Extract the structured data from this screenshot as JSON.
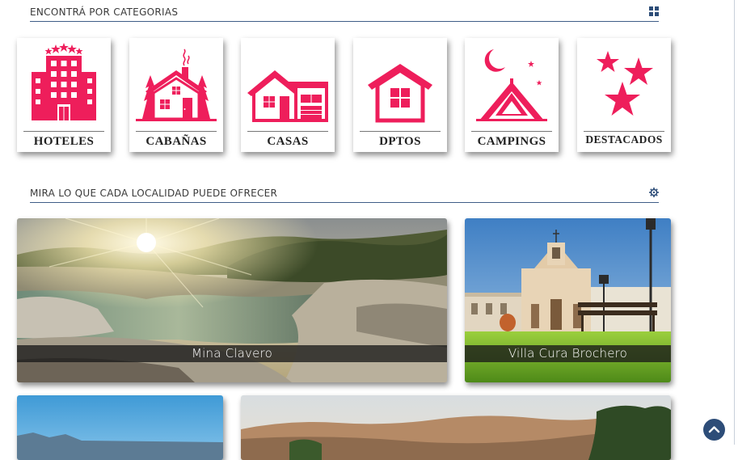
{
  "categories_section": {
    "title": "ENCONTRÁ POR CATEGORIAS",
    "icon": "grid-icon",
    "items": [
      {
        "label": "HOTELES",
        "icon": "hotel-icon"
      },
      {
        "label": "CABAÑAS",
        "icon": "cabin-icon"
      },
      {
        "label": "CASAS",
        "icon": "house-icon"
      },
      {
        "label": "DPTOS",
        "icon": "apartment-icon"
      },
      {
        "label": "CAMPINGS",
        "icon": "tent-icon"
      },
      {
        "label": "DESTACADOS",
        "icon": "stars-icon"
      }
    ],
    "accent_color": "#ee1e5b"
  },
  "localities_section": {
    "title": "MIRA LO QUE CADA LOCALIDAD PUEDE OFRECER",
    "icon": "gear-icon",
    "items": [
      {
        "name": "Mina Clavero"
      },
      {
        "name": "Villa Cura Brochero"
      },
      {
        "name": ""
      },
      {
        "name": ""
      }
    ]
  },
  "scroll_top": {
    "icon": "chevron-up-icon",
    "color": "#2d4d78"
  },
  "colors": {
    "heading_line": "#3f5d87",
    "accent": "#ee1e5b"
  }
}
